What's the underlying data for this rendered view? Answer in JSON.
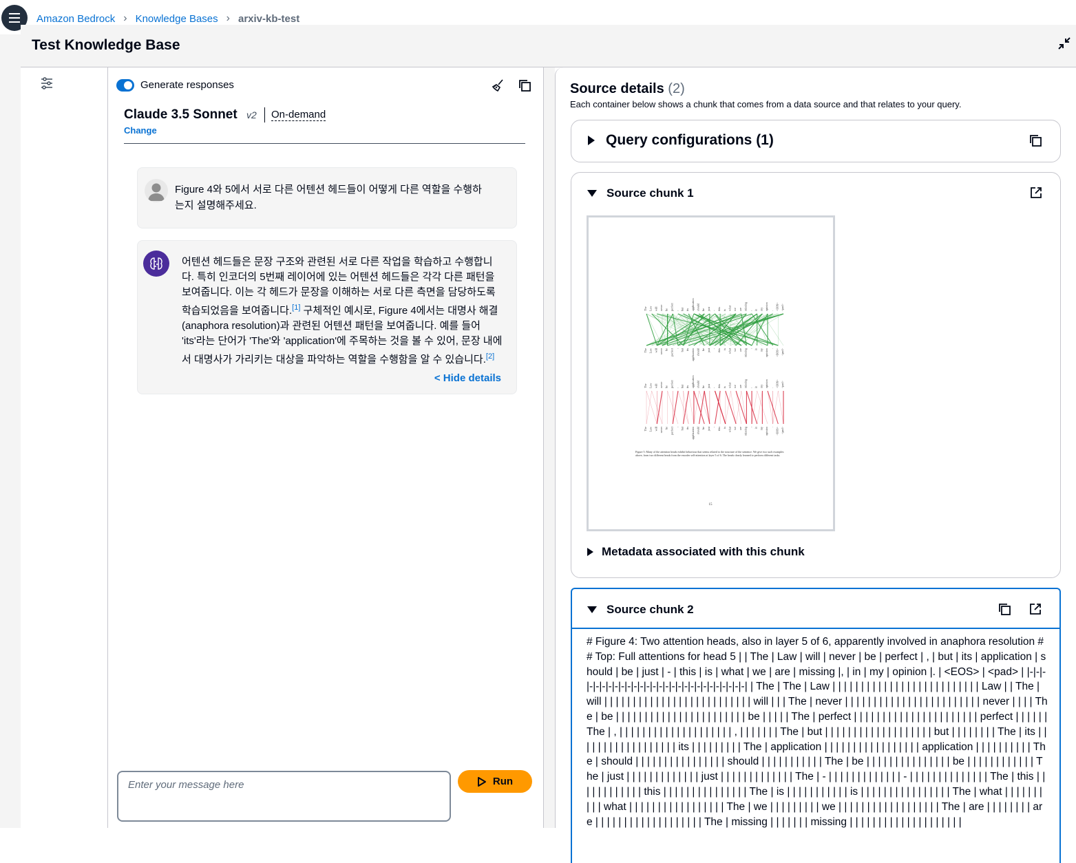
{
  "breadcrumb": {
    "items": [
      "Amazon Bedrock",
      "Knowledge Bases"
    ],
    "current": "arxiv-kb-test"
  },
  "page": {
    "title": "Test Knowledge Base"
  },
  "chat": {
    "generate_responses_label": "Generate responses",
    "generate_responses_on": true,
    "model": {
      "name": "Claude 3.5 Sonnet",
      "version": "v2",
      "mode": "On-demand",
      "change_label": "Change"
    },
    "user_message": "Figure 4와 5에서 서로 다른 어텐션 헤드들이 어떻게 다른 역할을 수행하는지 설명해주세요.",
    "ai_message": {
      "part1": "어텐션 헤드들은 문장 구조와 관련된 서로 다른 작업을 학습하고 수행합니다. 특히 인코더의 5번째 레이어에 있는 어텐션 헤드들은 각각 다른 패턴을 보여줍니다. 이는 각 헤드가 문장을 이해하는 서로 다른 측면을 담당하도록 학습되었음을 보여줍니다.",
      "cite1": "[1]",
      "part2": " 구체적인 예시로, Figure 4에서는 대명사 해결(anaphora resolution)과 관련된 어텐션 패턴을 보여줍니다. 예를 들어 'its'라는 단어가 'The'와 'application'에 주목하는 것을 볼 수 있어, 문장 내에서 대명사가 가리키는 대상을 파악하는 역할을 수행함을 알 수 있습니다.",
      "cite2": "[2]"
    },
    "hide_details_label": "< Hide details",
    "input_placeholder": "Enter your message here",
    "run_label": "Run"
  },
  "source": {
    "title": "Source details",
    "count": "(2)",
    "description": "Each container below shows a chunk that comes from a data source and that relates to your query.",
    "query_config_label": "Query configurations (1)",
    "chunk1": {
      "title": "Source chunk 1",
      "metadata_label": "Metadata associated with this chunk",
      "figure_caption": "Figure 5: Many of the attention heads exhibit behaviour that seems related to the structure of the sentence. We give two such examples above, from two different heads from the encoder self-attention at layer 5 of 6. The heads clearly learned to perform different tasks.",
      "page_number": "15",
      "tokens": [
        "The",
        "Law",
        "will",
        "never",
        "be",
        "perfect",
        ",",
        "but",
        "its",
        "application",
        "should",
        "be",
        "just",
        "-",
        "this",
        "is",
        "what",
        "we",
        "are",
        "missing",
        ",",
        "in",
        "my",
        "opinion",
        ".",
        "<EOS>",
        "<pad>"
      ]
    },
    "chunk2": {
      "title": "Source chunk 2",
      "text": "# Figure 4: Two attention heads, also in layer 5 of 6, apparently involved in anaphora resolution ## Top: Full attentions for head 5 | | The | Law | will | never | be | perfect | , | but | its | application | should | be | just | - | this | is | what | we | are | missing |, | in | my | opinion |. | <EOS> | <pad> | |-|-|-|-|-|-|-|-|-|-|-|-|-|-|-|-|-|-|-|-|-|-|-|-|-|-|-|-| | The | The | Law | | | | | | | | | | | | | | | | | | | | | | | | | | Law | | The | will | | | | | | | | | | | | | | | | | | | | | | | | | | will | | | The | never | | | | | | | | | | | | | | | | | | | | | | | | never | | | | The | be | | | | | | | | | | | | | | | | | | | | | | | be | | | | | The | perfect | | | | | | | | | | | | | | | | | | | | | | perfect | | | | | | The | , | | | | | | | | | | | | | | | | | | | | , | | | | | | | The | but | | | | | | | | | | | | | | | | | | | but | | | | | | | | The | its | | | | | | | | | | | | | | | | | | its | | | | | | | | | The | application | | | | | | | | | | | | | | | | | application | | | | | | | | | | The | should | | | | | | | | | | | | | | | | should | | | | | | | | | | | The | be | | | | | | | | | | | | | | | be | | | | | | | | | | | | The | just | | | | | | | | | | | | | just | | | | | | | | | | | | | The | - | | | | | | | | | | | | | - | | | | | | | | | | | | | | The | this | | | | | | | | | | | | this | | | | | | | | | | | | | | | The | is | | | | | | | | | | | is | | | | | | | | | | | | | | | | The | what | | | | | | | | | | what | | | | | | | | | | | | | | | | | The | we | | | | | | | | | we | | | | | | | | | | | | | | | | | | The | are | | | | | | | | are | | | | | | | | | | | | | | | | | | | The | missing | | | | | | | missing | | | | | | | | | | | | | | | | | | | |"
    }
  }
}
